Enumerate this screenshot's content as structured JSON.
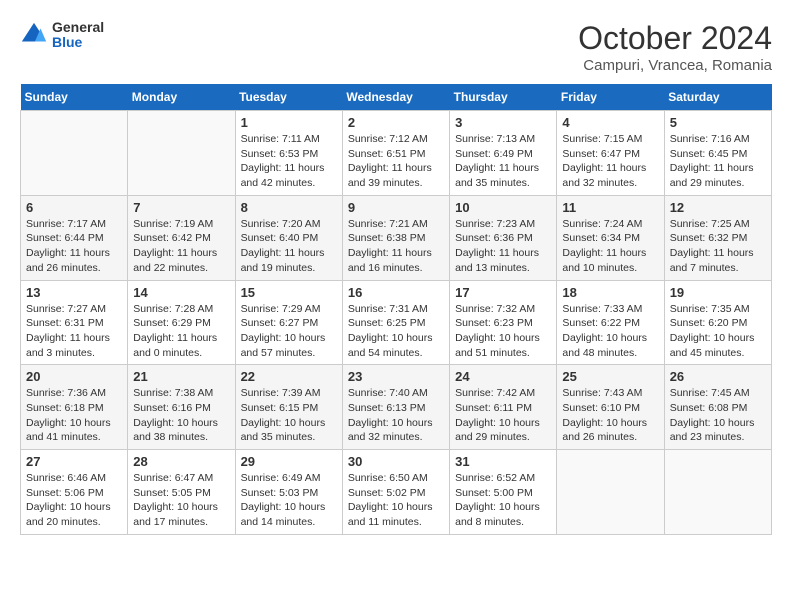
{
  "header": {
    "logo_general": "General",
    "logo_blue": "Blue",
    "month_title": "October 2024",
    "location": "Campuri, Vrancea, Romania"
  },
  "days_of_week": [
    "Sunday",
    "Monday",
    "Tuesday",
    "Wednesday",
    "Thursday",
    "Friday",
    "Saturday"
  ],
  "weeks": [
    [
      {
        "day": "",
        "sunrise": "",
        "sunset": "",
        "daylight": ""
      },
      {
        "day": "",
        "sunrise": "",
        "sunset": "",
        "daylight": ""
      },
      {
        "day": "1",
        "sunrise": "Sunrise: 7:11 AM",
        "sunset": "Sunset: 6:53 PM",
        "daylight": "Daylight: 11 hours and 42 minutes."
      },
      {
        "day": "2",
        "sunrise": "Sunrise: 7:12 AM",
        "sunset": "Sunset: 6:51 PM",
        "daylight": "Daylight: 11 hours and 39 minutes."
      },
      {
        "day": "3",
        "sunrise": "Sunrise: 7:13 AM",
        "sunset": "Sunset: 6:49 PM",
        "daylight": "Daylight: 11 hours and 35 minutes."
      },
      {
        "day": "4",
        "sunrise": "Sunrise: 7:15 AM",
        "sunset": "Sunset: 6:47 PM",
        "daylight": "Daylight: 11 hours and 32 minutes."
      },
      {
        "day": "5",
        "sunrise": "Sunrise: 7:16 AM",
        "sunset": "Sunset: 6:45 PM",
        "daylight": "Daylight: 11 hours and 29 minutes."
      }
    ],
    [
      {
        "day": "6",
        "sunrise": "Sunrise: 7:17 AM",
        "sunset": "Sunset: 6:44 PM",
        "daylight": "Daylight: 11 hours and 26 minutes."
      },
      {
        "day": "7",
        "sunrise": "Sunrise: 7:19 AM",
        "sunset": "Sunset: 6:42 PM",
        "daylight": "Daylight: 11 hours and 22 minutes."
      },
      {
        "day": "8",
        "sunrise": "Sunrise: 7:20 AM",
        "sunset": "Sunset: 6:40 PM",
        "daylight": "Daylight: 11 hours and 19 minutes."
      },
      {
        "day": "9",
        "sunrise": "Sunrise: 7:21 AM",
        "sunset": "Sunset: 6:38 PM",
        "daylight": "Daylight: 11 hours and 16 minutes."
      },
      {
        "day": "10",
        "sunrise": "Sunrise: 7:23 AM",
        "sunset": "Sunset: 6:36 PM",
        "daylight": "Daylight: 11 hours and 13 minutes."
      },
      {
        "day": "11",
        "sunrise": "Sunrise: 7:24 AM",
        "sunset": "Sunset: 6:34 PM",
        "daylight": "Daylight: 11 hours and 10 minutes."
      },
      {
        "day": "12",
        "sunrise": "Sunrise: 7:25 AM",
        "sunset": "Sunset: 6:32 PM",
        "daylight": "Daylight: 11 hours and 7 minutes."
      }
    ],
    [
      {
        "day": "13",
        "sunrise": "Sunrise: 7:27 AM",
        "sunset": "Sunset: 6:31 PM",
        "daylight": "Daylight: 11 hours and 3 minutes."
      },
      {
        "day": "14",
        "sunrise": "Sunrise: 7:28 AM",
        "sunset": "Sunset: 6:29 PM",
        "daylight": "Daylight: 11 hours and 0 minutes."
      },
      {
        "day": "15",
        "sunrise": "Sunrise: 7:29 AM",
        "sunset": "Sunset: 6:27 PM",
        "daylight": "Daylight: 10 hours and 57 minutes."
      },
      {
        "day": "16",
        "sunrise": "Sunrise: 7:31 AM",
        "sunset": "Sunset: 6:25 PM",
        "daylight": "Daylight: 10 hours and 54 minutes."
      },
      {
        "day": "17",
        "sunrise": "Sunrise: 7:32 AM",
        "sunset": "Sunset: 6:23 PM",
        "daylight": "Daylight: 10 hours and 51 minutes."
      },
      {
        "day": "18",
        "sunrise": "Sunrise: 7:33 AM",
        "sunset": "Sunset: 6:22 PM",
        "daylight": "Daylight: 10 hours and 48 minutes."
      },
      {
        "day": "19",
        "sunrise": "Sunrise: 7:35 AM",
        "sunset": "Sunset: 6:20 PM",
        "daylight": "Daylight: 10 hours and 45 minutes."
      }
    ],
    [
      {
        "day": "20",
        "sunrise": "Sunrise: 7:36 AM",
        "sunset": "Sunset: 6:18 PM",
        "daylight": "Daylight: 10 hours and 41 minutes."
      },
      {
        "day": "21",
        "sunrise": "Sunrise: 7:38 AM",
        "sunset": "Sunset: 6:16 PM",
        "daylight": "Daylight: 10 hours and 38 minutes."
      },
      {
        "day": "22",
        "sunrise": "Sunrise: 7:39 AM",
        "sunset": "Sunset: 6:15 PM",
        "daylight": "Daylight: 10 hours and 35 minutes."
      },
      {
        "day": "23",
        "sunrise": "Sunrise: 7:40 AM",
        "sunset": "Sunset: 6:13 PM",
        "daylight": "Daylight: 10 hours and 32 minutes."
      },
      {
        "day": "24",
        "sunrise": "Sunrise: 7:42 AM",
        "sunset": "Sunset: 6:11 PM",
        "daylight": "Daylight: 10 hours and 29 minutes."
      },
      {
        "day": "25",
        "sunrise": "Sunrise: 7:43 AM",
        "sunset": "Sunset: 6:10 PM",
        "daylight": "Daylight: 10 hours and 26 minutes."
      },
      {
        "day": "26",
        "sunrise": "Sunrise: 7:45 AM",
        "sunset": "Sunset: 6:08 PM",
        "daylight": "Daylight: 10 hours and 23 minutes."
      }
    ],
    [
      {
        "day": "27",
        "sunrise": "Sunrise: 6:46 AM",
        "sunset": "Sunset: 5:06 PM",
        "daylight": "Daylight: 10 hours and 20 minutes."
      },
      {
        "day": "28",
        "sunrise": "Sunrise: 6:47 AM",
        "sunset": "Sunset: 5:05 PM",
        "daylight": "Daylight: 10 hours and 17 minutes."
      },
      {
        "day": "29",
        "sunrise": "Sunrise: 6:49 AM",
        "sunset": "Sunset: 5:03 PM",
        "daylight": "Daylight: 10 hours and 14 minutes."
      },
      {
        "day": "30",
        "sunrise": "Sunrise: 6:50 AM",
        "sunset": "Sunset: 5:02 PM",
        "daylight": "Daylight: 10 hours and 11 minutes."
      },
      {
        "day": "31",
        "sunrise": "Sunrise: 6:52 AM",
        "sunset": "Sunset: 5:00 PM",
        "daylight": "Daylight: 10 hours and 8 minutes."
      },
      {
        "day": "",
        "sunrise": "",
        "sunset": "",
        "daylight": ""
      },
      {
        "day": "",
        "sunrise": "",
        "sunset": "",
        "daylight": ""
      }
    ]
  ]
}
